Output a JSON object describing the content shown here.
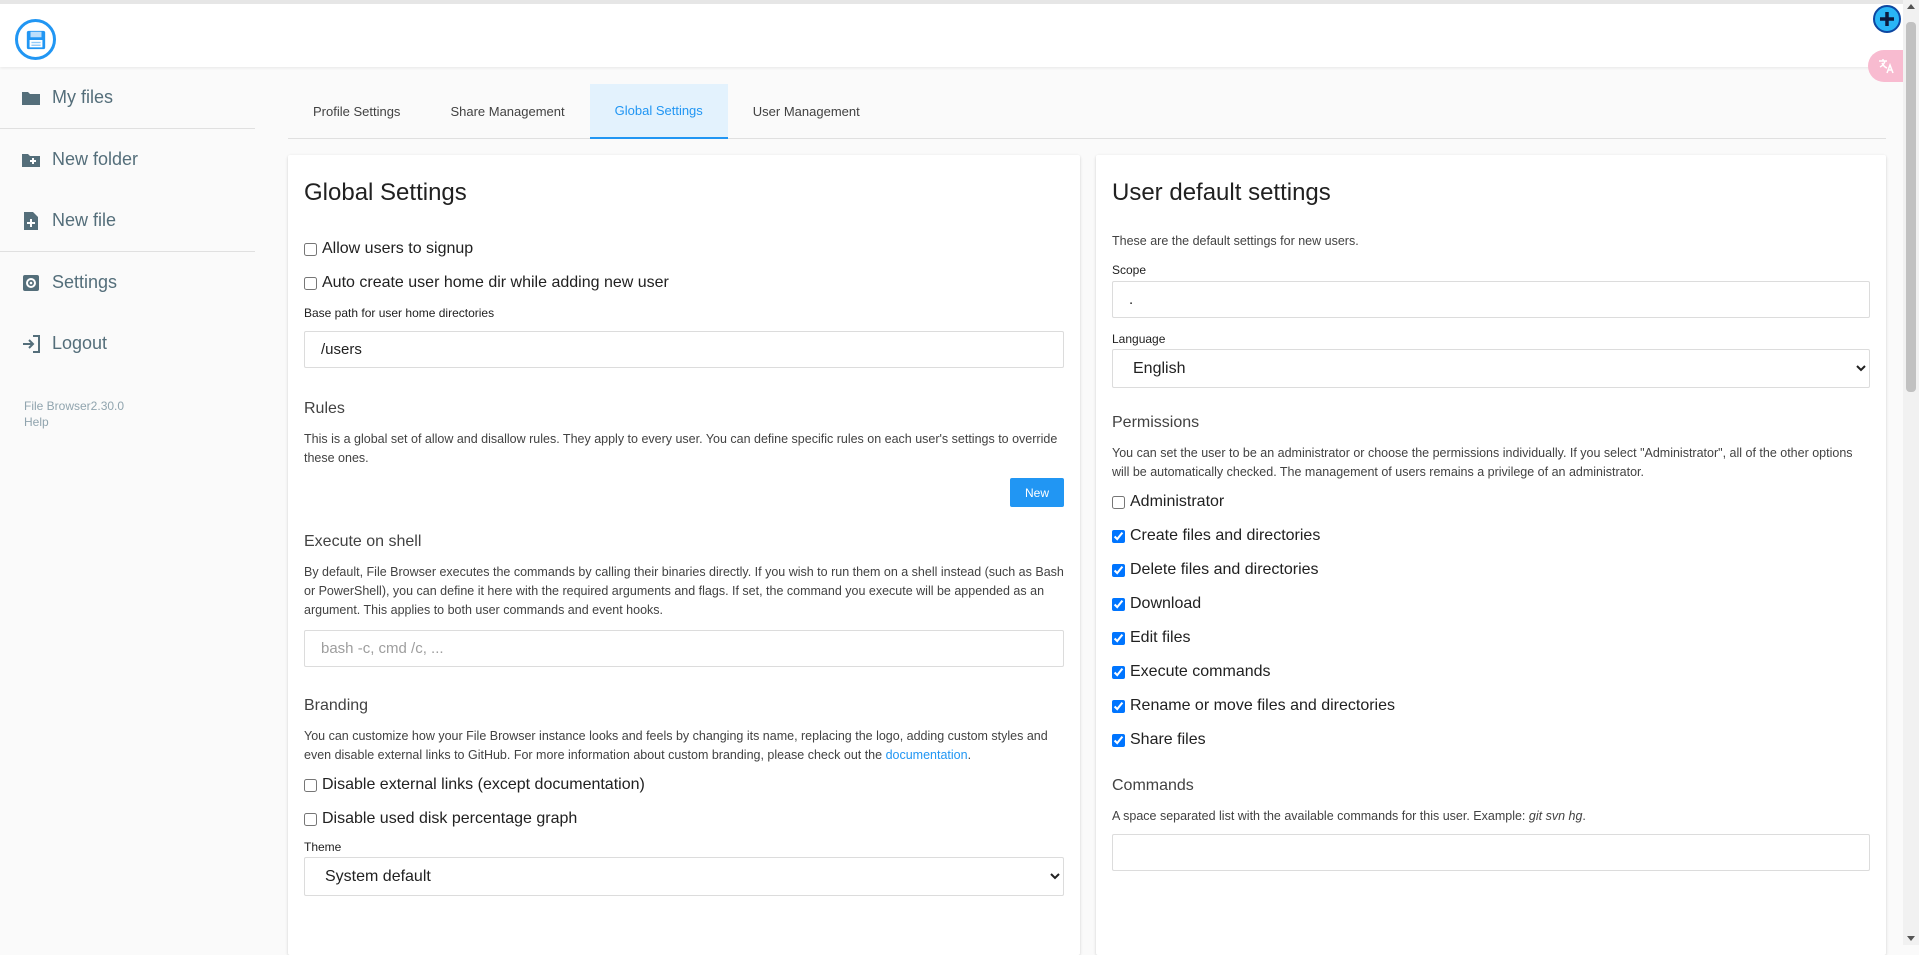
{
  "sidebar": {
    "items": [
      {
        "label": "My files",
        "icon": "folder-icon"
      },
      {
        "label": "New folder",
        "icon": "new-folder-icon"
      },
      {
        "label": "New file",
        "icon": "new-file-icon"
      },
      {
        "label": "Settings",
        "icon": "settings-icon"
      },
      {
        "label": "Logout",
        "icon": "logout-icon"
      }
    ],
    "version": "File Browser2.30.0",
    "help": "Help"
  },
  "tabs": [
    {
      "label": "Profile Settings"
    },
    {
      "label": "Share Management"
    },
    {
      "label": "Global Settings",
      "active": true
    },
    {
      "label": "User Management"
    }
  ],
  "global": {
    "title": "Global Settings",
    "allow_signup": {
      "label": "Allow users to signup",
      "checked": false
    },
    "auto_home": {
      "label": "Auto create user home dir while adding new user",
      "checked": false
    },
    "base_path_label": "Base path for user home directories",
    "base_path_value": "/users",
    "rules_title": "Rules",
    "rules_desc": "This is a global set of allow and disallow rules. They apply to every user. You can define specific rules on each user's settings to override these ones.",
    "new_button": "New",
    "shell_title": "Execute on shell",
    "shell_desc": "By default, File Browser executes the commands by calling their binaries directly. If you wish to run them on a shell instead (such as Bash or PowerShell), you can define it here with the required arguments and flags. If set, the command you execute will be appended as an argument. This applies to both user commands and event hooks.",
    "shell_placeholder": "bash -c, cmd /c, ...",
    "branding_title": "Branding",
    "branding_desc": "You can customize how your File Browser instance looks and feels by changing its name, replacing the logo, adding custom styles and even disable external links to GitHub. For more information about custom branding, please check out the",
    "branding_link": "documentation",
    "branding_end": ".",
    "disable_external": {
      "label": "Disable external links (except documentation)",
      "checked": false
    },
    "disable_disk": {
      "label": "Disable used disk percentage graph",
      "checked": false
    },
    "theme_label": "Theme",
    "theme_value": "System default"
  },
  "user_defaults": {
    "title": "User default settings",
    "desc": "These are the default settings for new users.",
    "scope_label": "Scope",
    "scope_value": ".",
    "language_label": "Language",
    "language_value": "English",
    "permissions_title": "Permissions",
    "permissions_desc": "You can set the user to be an administrator or choose the permissions individually. If you select \"Administrator\", all of the other options will be automatically checked. The management of users remains a privilege of an administrator.",
    "permissions": [
      {
        "label": "Administrator",
        "checked": false
      },
      {
        "label": "Create files and directories",
        "checked": true
      },
      {
        "label": "Delete files and directories",
        "checked": true
      },
      {
        "label": "Download",
        "checked": true
      },
      {
        "label": "Edit files",
        "checked": true
      },
      {
        "label": "Execute commands",
        "checked": true
      },
      {
        "label": "Rename or move files and directories",
        "checked": true
      },
      {
        "label": "Share files",
        "checked": true
      }
    ],
    "commands_title": "Commands",
    "commands_desc": "A space separated list with the available commands for this user. Example:",
    "commands_example": "git svn hg",
    "commands_end": ".",
    "commands_value": ""
  },
  "colors": {
    "accent": "#2196f3",
    "sidebar_text": "#546e7a"
  }
}
